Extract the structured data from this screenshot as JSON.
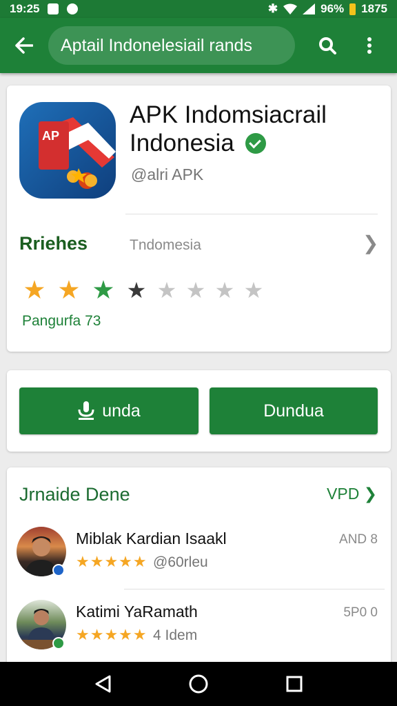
{
  "status_bar": {
    "time": "19:25",
    "battery": "96%",
    "clock_right": "1875"
  },
  "app_bar": {
    "search_text": "Aptail Indonelesiail rands"
  },
  "app": {
    "name": "APK Indomsiacrail Indonesia",
    "developer": "@alri APK",
    "icon_text": "AP",
    "category_label": "Rriehes",
    "category_value": "Tndomesia",
    "rating_stars": 3,
    "rating_total": 8,
    "rating_count_text": "Pangurfa 73"
  },
  "actions": {
    "install_label": "unda",
    "open_label": "Dundua"
  },
  "reviews": {
    "title": "Jrnaide Dene",
    "more_label": "VPD",
    "items": [
      {
        "name": "Miblak Kardian Isaakl",
        "stars": "★★★★★",
        "meta": "@60rleu",
        "date": "AND 8"
      },
      {
        "name": "Katimi YaRamath",
        "stars": "★★★★★",
        "meta": "4 Idem",
        "date": "5P0 0"
      }
    ]
  },
  "colors": {
    "primary": "#1e8138",
    "status_bar": "#1d7a35",
    "star": "#f5a623"
  },
  "icons": [
    "back-arrow-icon",
    "search-icon",
    "more-vert-icon",
    "verified-icon",
    "chevron-right-icon",
    "download-icon",
    "nav-back-icon",
    "nav-home-icon",
    "nav-recents-icon"
  ]
}
